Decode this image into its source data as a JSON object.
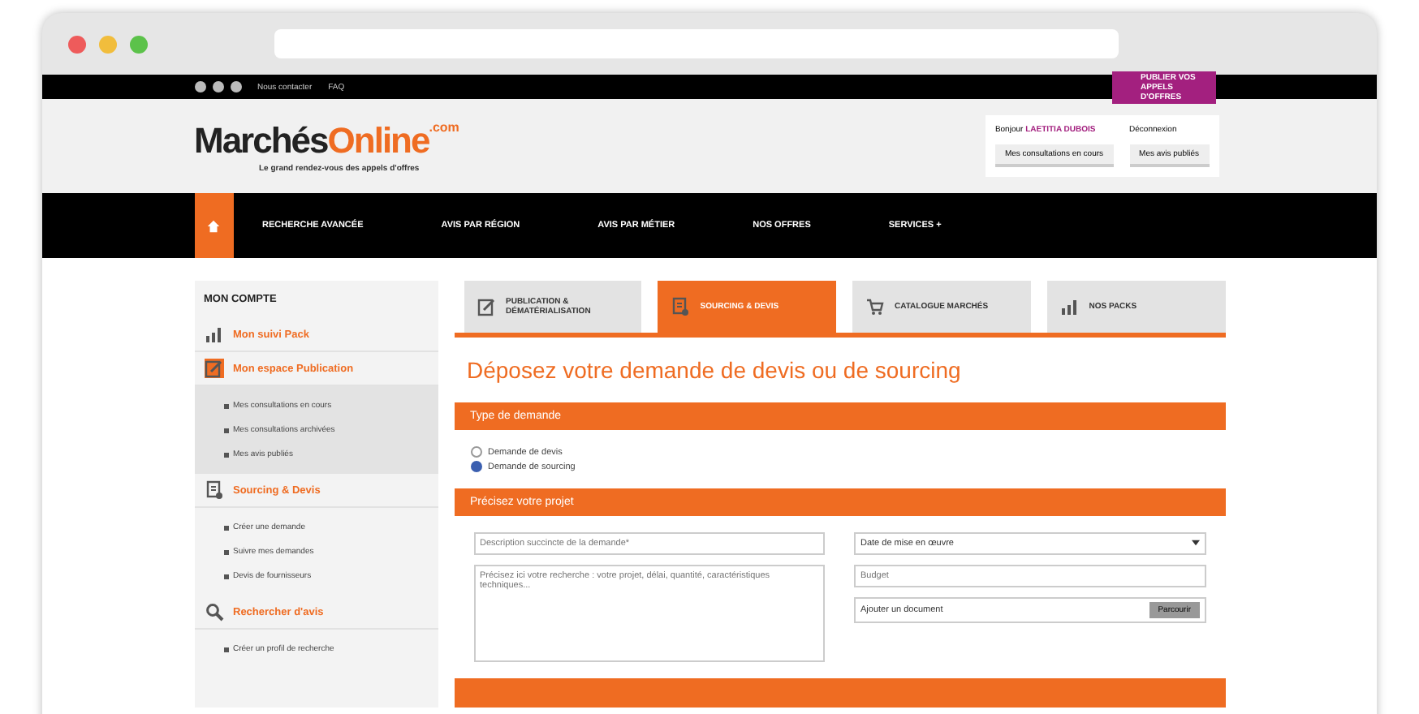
{
  "top_bar": {
    "links": [
      "Nous contacter",
      "FAQ"
    ],
    "badge": "PUBLIER VOS APPELS D'OFFRES"
  },
  "logo": {
    "part_1": "Marchés",
    "part_2": "Online",
    "suffix": ".com",
    "tagline": "Le grand rendez-vous des appels d'offres"
  },
  "account": {
    "greeting": "Bonjour",
    "user": "LAETITIA DUBOIS",
    "logout": "Déconnexion",
    "buttons": [
      "Mes consultations en cours",
      "Mes avis publiés"
    ]
  },
  "nav": {
    "items": [
      "RECHERCHE AVANCÉE",
      "AVIS PAR RÉGION",
      "AVIS PAR MÉTIER",
      "NOS OFFRES",
      "SERVICES +"
    ]
  },
  "sidebar": {
    "title": "MON COMPTE",
    "sections": [
      {
        "label": "Mon suivi Pack",
        "selected": false
      },
      {
        "label": "Mon espace Publication",
        "selected": true,
        "children": [
          "Mes consultations en cours",
          "Mes consultations archivées",
          "Mes avis publiés"
        ]
      },
      {
        "label": "Sourcing & Devis",
        "selected": false,
        "children": [
          "Créer une demande",
          "Suivre mes demandes",
          "Devis de fournisseurs"
        ]
      },
      {
        "label": "Rechercher d'avis",
        "selected": false,
        "children": [
          "Créer un profil de recherche"
        ]
      }
    ]
  },
  "tabs": [
    {
      "label": "PUBLICATION & DÉMATÉRIALISATION",
      "selected": false
    },
    {
      "label": "SOURCING & DEVIS",
      "selected": true
    },
    {
      "label": "CATALOGUE MARCHÉS",
      "selected": false
    },
    {
      "label": "NOS PACKS",
      "selected": false
    }
  ],
  "form": {
    "title": "Déposez votre demande de devis ou de sourcing",
    "type_section": "Type de demande",
    "options": [
      {
        "label": "Demande de devis",
        "selected": false
      },
      {
        "label": "Demande de sourcing",
        "selected": true
      }
    ],
    "project_section": "Précisez votre projet",
    "description_placeholder": "Description succincte de la demande*",
    "details_placeholder": "Précisez ici votre recherche : votre projet, délai, quantité, caractéristiques techniques...",
    "date_select": "Date de mise en œuvre",
    "budget_placeholder": "Budget",
    "file_label": "Ajouter un document",
    "file_button": "Parcourir"
  }
}
